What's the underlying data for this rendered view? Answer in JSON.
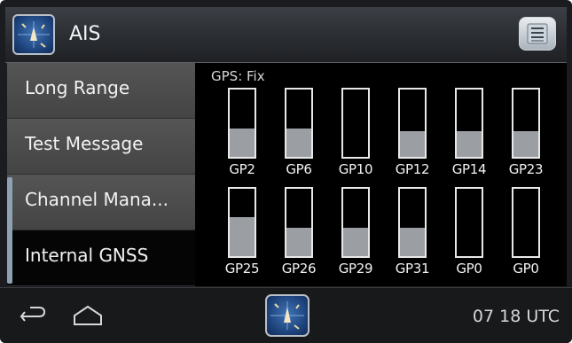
{
  "header": {
    "title": "AIS",
    "app_icon": "radar-icon",
    "menu_icon": "list-menu-icon"
  },
  "sidebar": {
    "items": [
      {
        "label": "Long Range",
        "active": false
      },
      {
        "label": "Test Message",
        "active": false
      },
      {
        "label": "Channel Mana...",
        "active": false
      },
      {
        "label": "Internal GNSS",
        "active": true
      }
    ]
  },
  "gnss": {
    "status": "GPS: Fix",
    "satellites": [
      {
        "label": "GP2",
        "level": 0.42
      },
      {
        "label": "GP6",
        "level": 0.42
      },
      {
        "label": "GP10",
        "level": 0.0
      },
      {
        "label": "GP12",
        "level": 0.38
      },
      {
        "label": "GP14",
        "level": 0.38
      },
      {
        "label": "GP23",
        "level": 0.38
      },
      {
        "label": "GP25",
        "level": 0.58
      },
      {
        "label": "GP26",
        "level": 0.42
      },
      {
        "label": "GP29",
        "level": 0.42
      },
      {
        "label": "GP31",
        "level": 0.42
      },
      {
        "label": "GP0",
        "level": 0.0
      },
      {
        "label": "GP0",
        "level": 0.0
      }
    ]
  },
  "bottombar": {
    "time": "07 18 UTC",
    "back_icon": "back-arrow-icon",
    "home_icon": "home-icon"
  },
  "colors": {
    "bar_fill": "#9b9fa3",
    "background": "#000000",
    "sidebar_item": "#4a4a4a"
  }
}
